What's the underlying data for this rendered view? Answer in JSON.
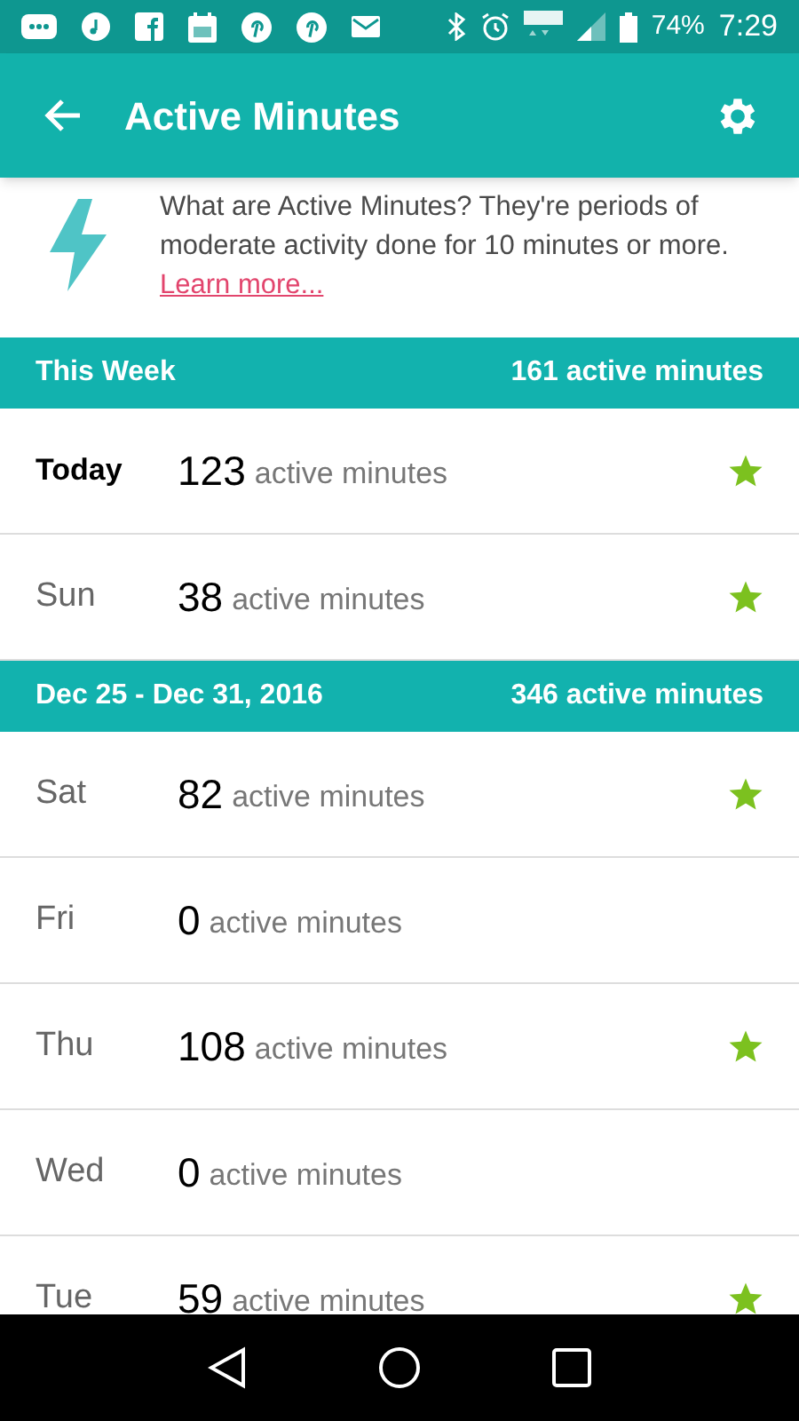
{
  "status_bar": {
    "battery": "74%",
    "time": "7:29"
  },
  "app_bar": {
    "title": "Active Minutes"
  },
  "info": {
    "text": "What are Active Minutes? They're periods of moderate activity done for 10 minutes or more.",
    "link": "Learn more..."
  },
  "sections": [
    {
      "title": "This Week",
      "total": "161 active minutes",
      "rows": [
        {
          "day": "Today",
          "highlighted": true,
          "value": "123",
          "unit": "active minutes",
          "starred": true
        },
        {
          "day": "Sun",
          "highlighted": false,
          "value": "38",
          "unit": "active minutes",
          "starred": true
        }
      ]
    },
    {
      "title": "Dec 25 - Dec 31, 2016",
      "total": "346 active minutes",
      "rows": [
        {
          "day": "Sat",
          "highlighted": false,
          "value": "82",
          "unit": "active minutes",
          "starred": true
        },
        {
          "day": "Fri",
          "highlighted": false,
          "value": "0",
          "unit": "active minutes",
          "starred": false
        },
        {
          "day": "Thu",
          "highlighted": false,
          "value": "108",
          "unit": "active minutes",
          "starred": true
        },
        {
          "day": "Wed",
          "highlighted": false,
          "value": "0",
          "unit": "active minutes",
          "starred": false
        },
        {
          "day": "Tue",
          "highlighted": false,
          "value": "59",
          "unit": "active minutes",
          "starred": true
        }
      ]
    }
  ]
}
